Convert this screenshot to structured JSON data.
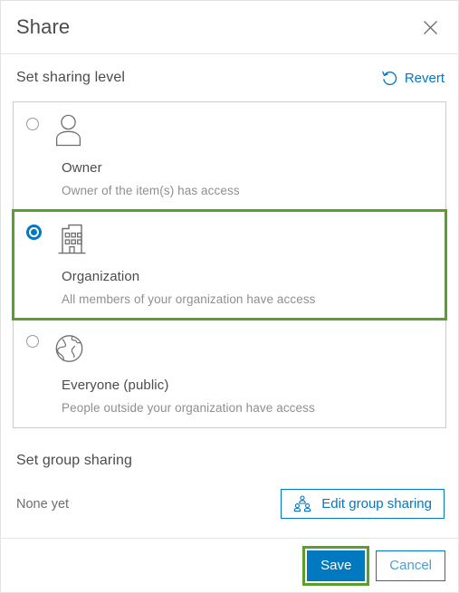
{
  "dialog": {
    "title": "Share",
    "close_icon": "close-icon"
  },
  "sharing_level": {
    "section_title": "Set sharing level",
    "revert_label": "Revert",
    "revert_icon": "revert-circular-arrow-icon",
    "options": [
      {
        "id": "owner",
        "label": "Owner",
        "description": "Owner of the item(s) has access",
        "icon": "person-icon",
        "selected": false,
        "highlighted": false
      },
      {
        "id": "organization",
        "label": "Organization",
        "description": "All members of your organization have access",
        "icon": "building-icon",
        "selected": true,
        "highlighted": true
      },
      {
        "id": "everyone",
        "label": "Everyone (public)",
        "description": "People outside your organization have access",
        "icon": "globe-icon",
        "selected": false,
        "highlighted": false
      }
    ]
  },
  "group_sharing": {
    "section_title": "Set group sharing",
    "status_text": "None yet",
    "edit_button_label": "Edit group sharing",
    "edit_button_icon": "group-people-icon"
  },
  "footer": {
    "save_label": "Save",
    "cancel_label": "Cancel"
  },
  "colors": {
    "accent_blue": "#0079c1",
    "highlight_green": "#5a9e2c",
    "text_primary": "#4c4c4c",
    "text_muted": "#8f8f8f",
    "border": "#cccccc"
  }
}
